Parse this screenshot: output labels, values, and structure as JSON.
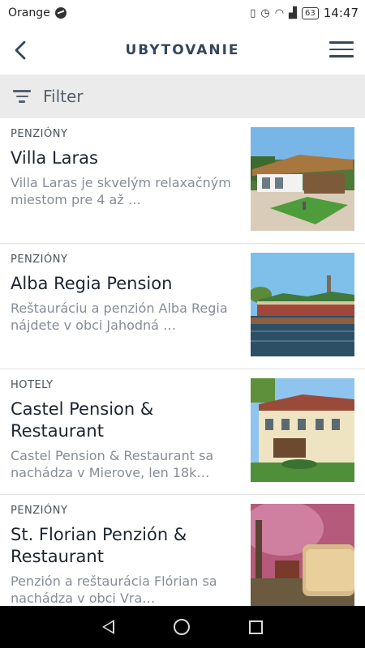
{
  "status_bar": {
    "carrier": "Orange",
    "battery": "63",
    "time": "14:47",
    "icons": [
      "messenger-icon",
      "vibrate-icon",
      "alarm-icon",
      "wifi-icon",
      "signal-icon",
      "battery-icon"
    ]
  },
  "header": {
    "title": "UBYTOVANIE",
    "back_icon": "back-arrow-icon",
    "menu_icon": "hamburger-menu-icon"
  },
  "filter": {
    "label": "Filter",
    "icon": "filter-icon"
  },
  "listings": [
    {
      "category": "PENZIÓNY",
      "name": "Villa Laras",
      "description": "Villa Laras je skvelým relaxačným miestom pre 4 až …"
    },
    {
      "category": "PENZIÓNY",
      "name": "Alba Regia Pension",
      "description": "Reštauráciu a penzión Alba Regia nájdete v obci Jahodná …"
    },
    {
      "category": "HOTELY",
      "name": "Castel Pension & Restaurant",
      "description": "Castel Pension & Restaurant sa nachádza v Mierove, len 18k…"
    },
    {
      "category": "PENZIÓNY",
      "name": "St. Florian Penzión & Restaurant",
      "description": "Penzión a reštaurácia Flórian sa nachádza v obci Vra…"
    }
  ],
  "colors": {
    "header_text": "#34475b",
    "filter_bar_bg": "#ebebeb",
    "description_text": "#868d96"
  }
}
